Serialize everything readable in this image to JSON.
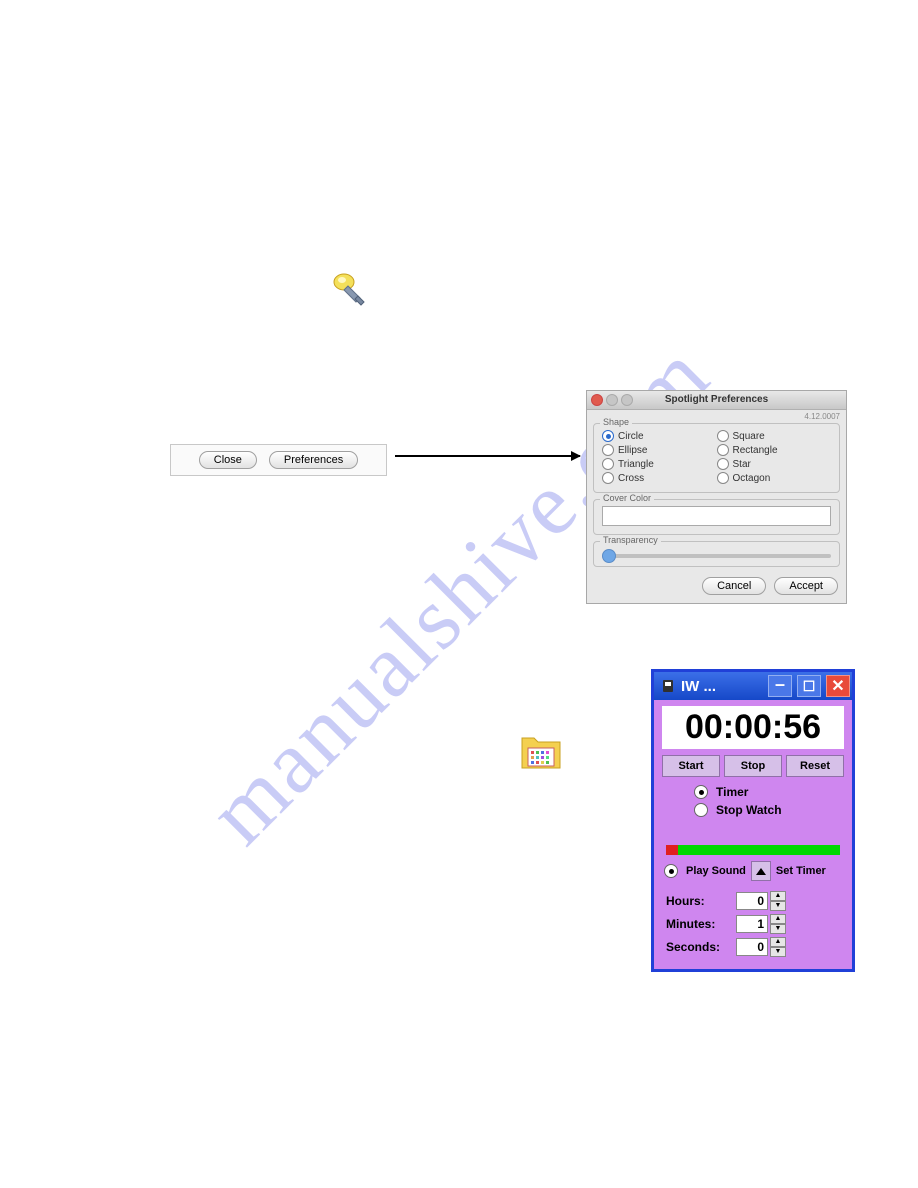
{
  "watermark": "manualshive.com",
  "toolbar": {
    "close_label": "Close",
    "preferences_label": "Preferences"
  },
  "prefs": {
    "title": "Spotlight Preferences",
    "version": "4.12.0007",
    "shape_legend": "Shape",
    "shapes_col1": [
      "Circle",
      "Ellipse",
      "Triangle",
      "Cross"
    ],
    "shapes_col2": [
      "Square",
      "Rectangle",
      "Star",
      "Octagon"
    ],
    "selected_shape": "Circle",
    "cover_legend": "Cover Color",
    "trans_legend": "Transparency",
    "cancel": "Cancel",
    "accept": "Accept"
  },
  "timer": {
    "title": "IW ...",
    "display": "00:00:56",
    "start": "Start",
    "stop": "Stop",
    "reset": "Reset",
    "mode_timer": "Timer",
    "mode_stopwatch": "Stop Watch",
    "play_sound": "Play Sound",
    "set_timer": "Set Timer",
    "hours_label": "Hours:",
    "minutes_label": "Minutes:",
    "seconds_label": "Seconds:",
    "hours_val": "0",
    "minutes_val": "1",
    "seconds_val": "0"
  }
}
